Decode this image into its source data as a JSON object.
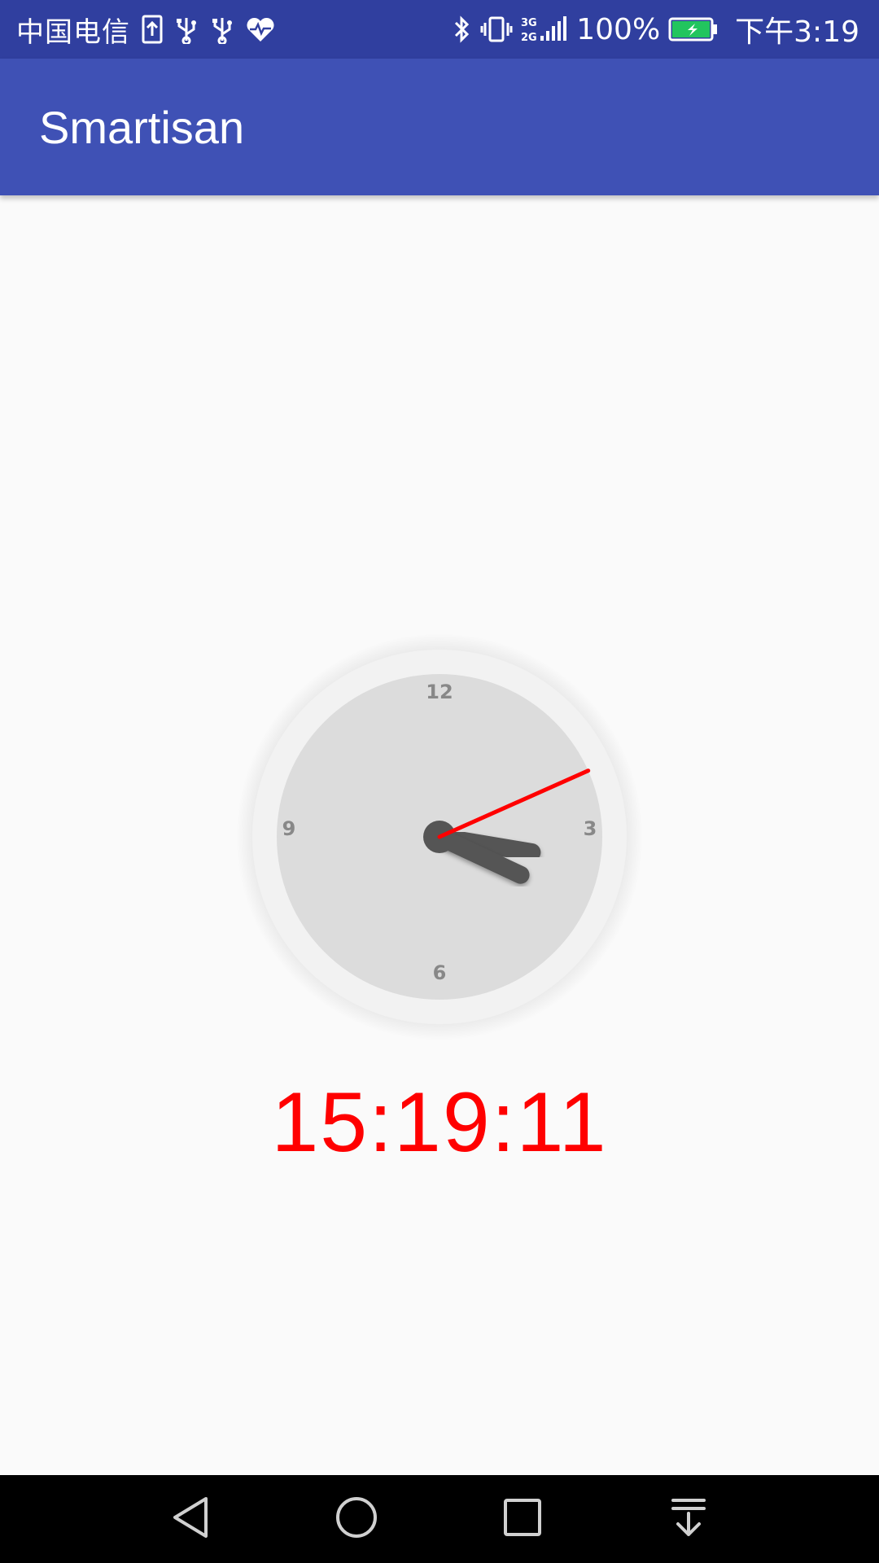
{
  "status_bar": {
    "carrier": "中国电信",
    "battery_percent": "100%",
    "time": "下午3:19",
    "icons": [
      "sim-upload-icon",
      "usb-icon",
      "usb-icon",
      "heart-icon",
      "bluetooth-icon",
      "vibrate-icon",
      "signal-icon",
      "battery-charging-icon"
    ],
    "colors": {
      "background": "#303f9f",
      "battery_fill": "#22c55e"
    }
  },
  "app_bar": {
    "title": "Smartisan",
    "color": "#3f51b5"
  },
  "clock": {
    "numerals": {
      "top": "12",
      "right": "3",
      "bottom": "6",
      "left": "9"
    },
    "time": {
      "hours": 15,
      "minutes": 19,
      "seconds": 11
    },
    "colors": {
      "outer_ring": "#f2f2f2",
      "face": "#dcdcdc",
      "hands": "#555555",
      "second_hand": "#ff0000",
      "numerals": "#888888"
    }
  },
  "digital_time": {
    "text": "15:19:11",
    "color": "#ff0000"
  },
  "nav_bar": {
    "buttons": [
      "back-icon",
      "home-icon",
      "recents-icon",
      "notifications-pull-icon"
    ]
  }
}
